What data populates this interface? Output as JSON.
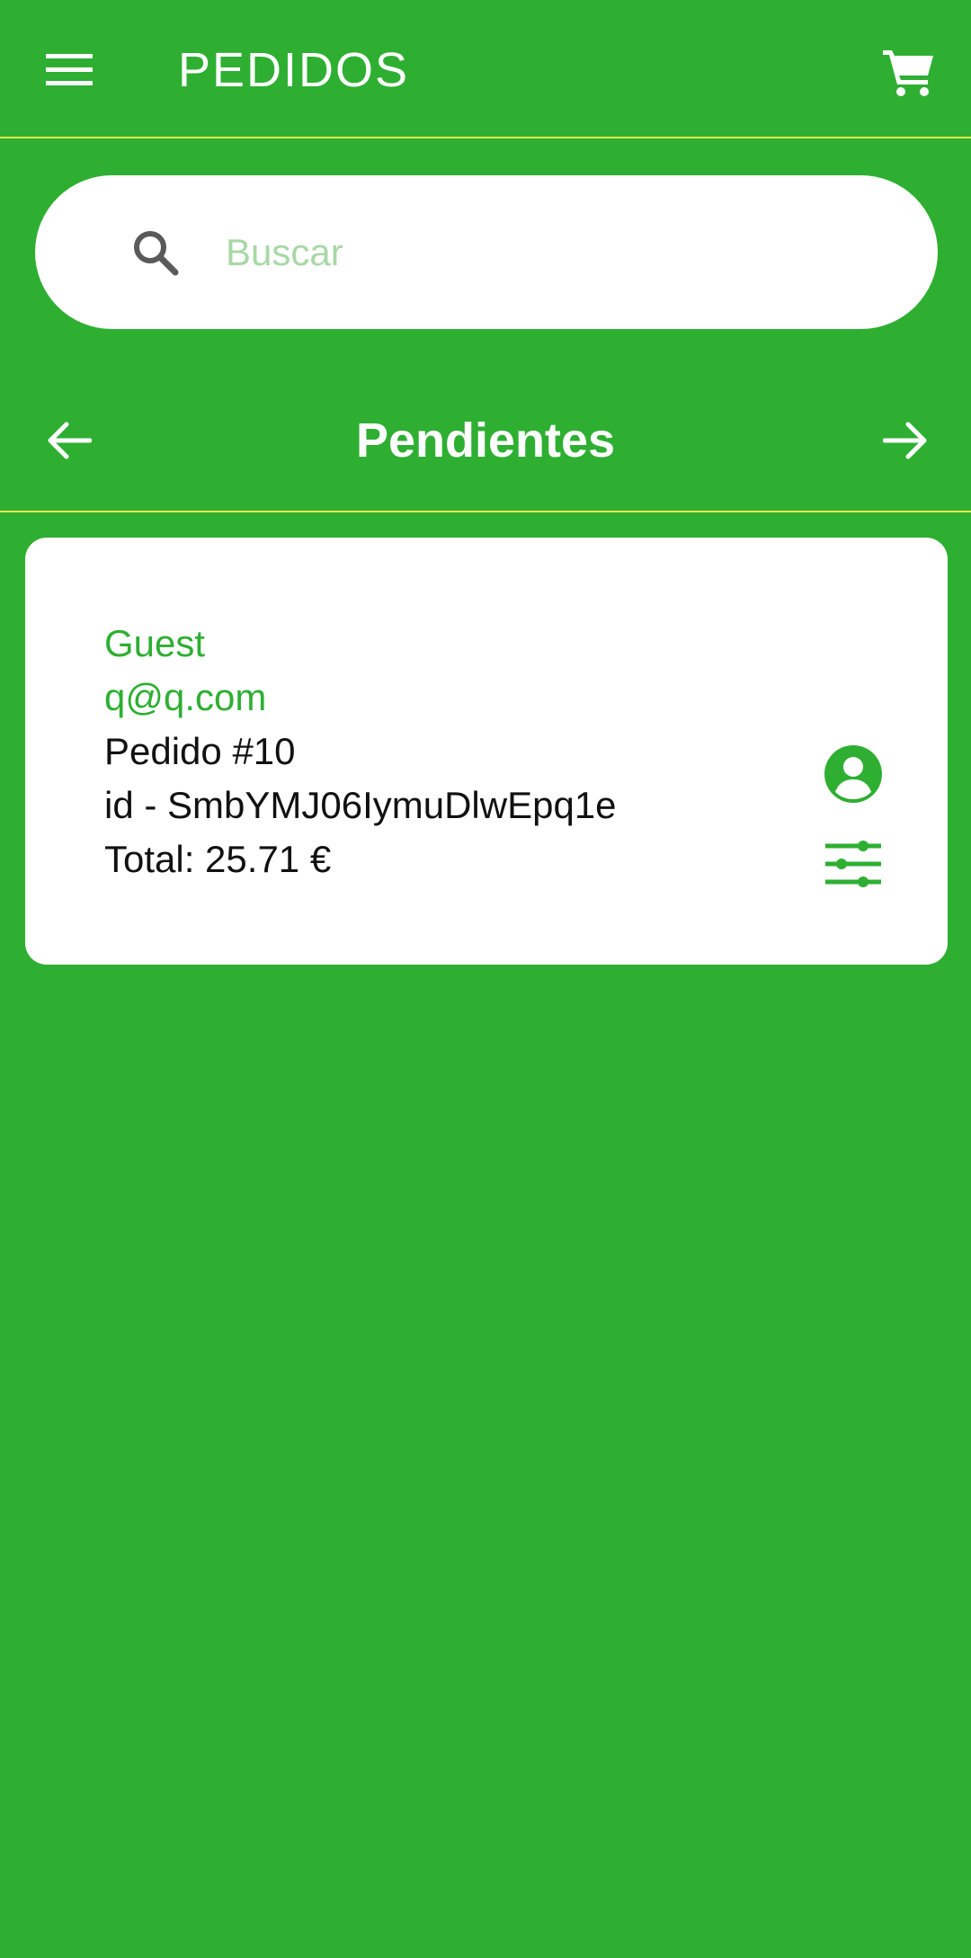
{
  "header": {
    "title": "PEDIDOS",
    "menu_icon": "menu-icon",
    "cart_icon": "cart-icon"
  },
  "search": {
    "placeholder": "Buscar",
    "value": "",
    "icon": "search-icon"
  },
  "status_nav": {
    "label": "Pendientes",
    "prev_icon": "arrow-left-icon",
    "next_icon": "arrow-right-icon"
  },
  "orders": [
    {
      "customer": "Guest",
      "email": "q@q.com",
      "order_number": "Pedido #10",
      "id_line": "id - SmbYMJ06IymuDlwEpq1e",
      "total_line": "Total: 25.71 €",
      "profile_icon": "account-circle-icon",
      "options_icon": "tune-icon"
    }
  ],
  "colors": {
    "background": "#2eaf32",
    "card": "#ffffff",
    "accent": "#2eaf32",
    "divider": "#e6e64a",
    "placeholder": "#a8d8a6"
  }
}
